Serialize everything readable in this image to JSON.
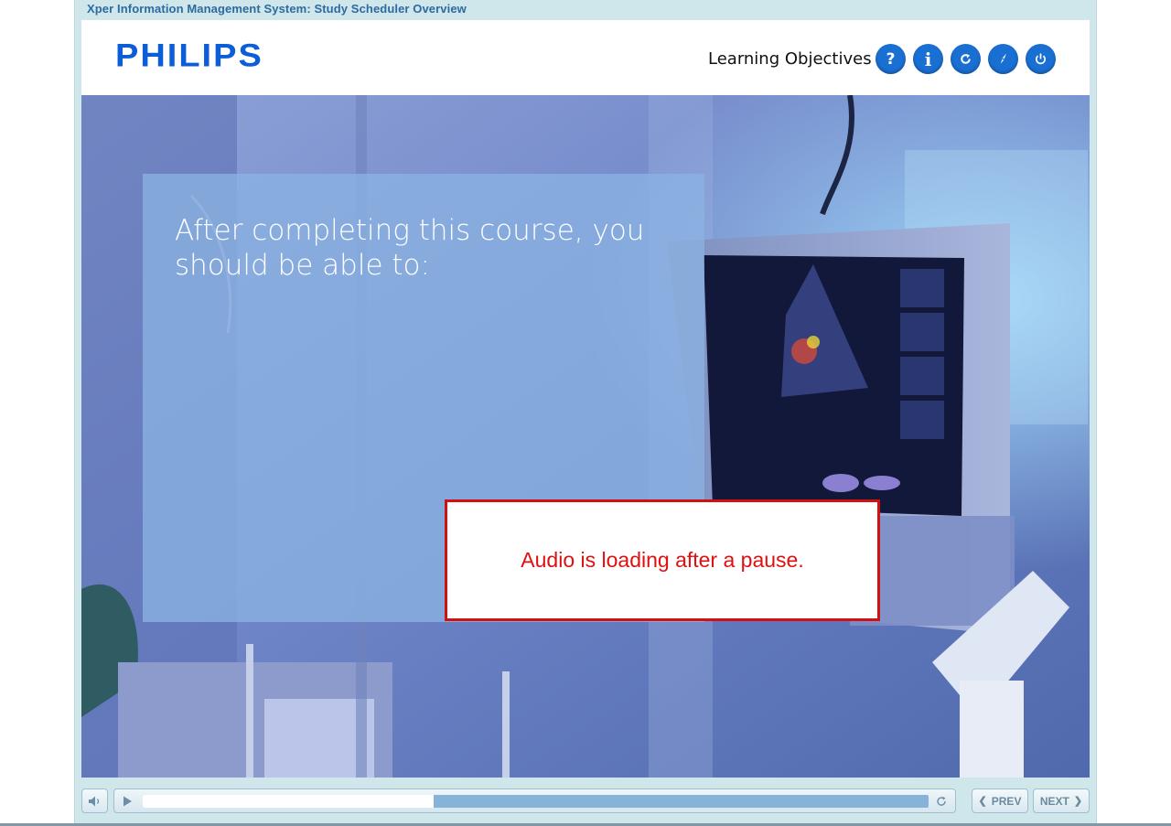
{
  "course": {
    "title": "Xper Information Management System: Study Scheduler Overview"
  },
  "header": {
    "logo_text": "PHILIPS",
    "section_label": "Learning Objectives",
    "buttons": [
      {
        "icon": "help-icon",
        "glyph": "?"
      },
      {
        "icon": "info-icon",
        "glyph": "i"
      },
      {
        "icon": "replay-icon"
      },
      {
        "icon": "compass-icon"
      },
      {
        "icon": "power-icon"
      }
    ]
  },
  "slide": {
    "heading": "After completing this course, you should be able to:",
    "alert": "Audio is loading after a pause."
  },
  "controls": {
    "progress_fraction": 0.37,
    "prev_label": "PREV",
    "next_label": "NEXT"
  },
  "colors": {
    "accent": "#1a6fd3",
    "alert": "#e01010",
    "frame": "#cfe6ea"
  }
}
